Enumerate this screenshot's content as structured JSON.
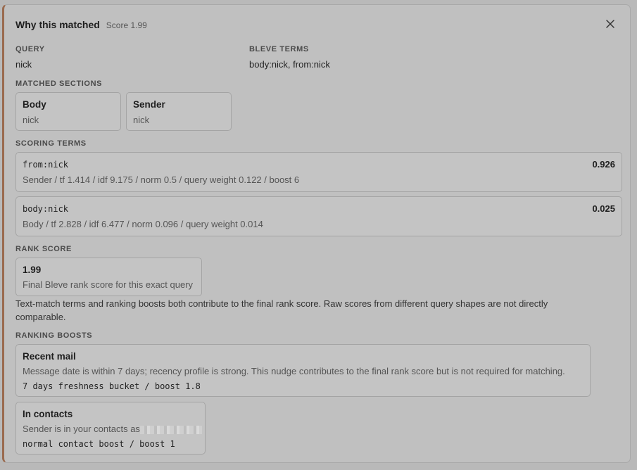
{
  "header": {
    "title": "Why this matched",
    "score": "Score 1.99",
    "close_icon": "close-icon"
  },
  "query": {
    "label": "QUERY",
    "value": "nick"
  },
  "bleve": {
    "label": "BLEVE TERMS",
    "value": "body:nick, from:nick"
  },
  "matched_sections": {
    "label": "MATCHED SECTIONS",
    "items": [
      {
        "title": "Body",
        "value": "nick"
      },
      {
        "title": "Sender",
        "value": "nick"
      }
    ]
  },
  "scoring_terms": {
    "label": "SCORING TERMS",
    "items": [
      {
        "term": "from:nick",
        "weight": "0.926",
        "detail": "Sender / tf 1.414 / idf 9.175 / norm 0.5 / query weight 0.122 / boost 6"
      },
      {
        "term": "body:nick",
        "weight": "0.025",
        "detail": "Body / tf 2.828 / idf 6.477 / norm 0.096 / query weight 0.014"
      }
    ]
  },
  "rank_score": {
    "label": "RANK SCORE",
    "value": "1.99",
    "description": "Final Bleve rank score for this exact query"
  },
  "explanation": "Text-match terms and ranking boosts both contribute to the final rank score. Raw scores from different query shapes are not directly comparable.",
  "ranking_boosts": {
    "label": "RANKING BOOSTS",
    "items": [
      {
        "title": "Recent mail",
        "description": "Message date is within 7 days; recency profile is strong. This nudge contributes to the final rank score but is not required for matching.",
        "detail": "7 days freshness bucket / boost 1.8"
      },
      {
        "title": "In contacts",
        "description": "Sender is in your contacts as",
        "detail": "normal contact boost / boost 1"
      }
    ]
  }
}
